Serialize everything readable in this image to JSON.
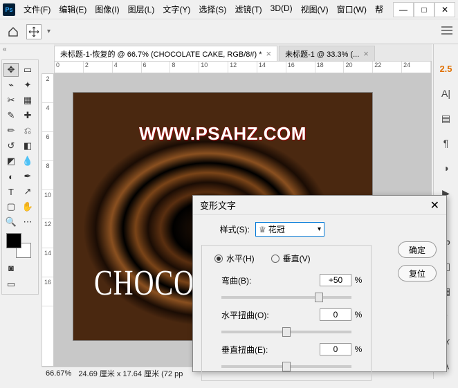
{
  "app": {
    "logo": "Ps"
  },
  "menu": [
    "文件(F)",
    "编辑(E)",
    "图像(I)",
    "图层(L)",
    "文字(Y)",
    "选择(S)",
    "滤镜(T)",
    "3D(D)",
    "视图(V)",
    "窗口(W)",
    "帮"
  ],
  "tabs": [
    {
      "label": "未标题-1-恢复的 @ 66.7% (CHOCOLATE CAKE, RGB/8#) *",
      "active": true
    },
    {
      "label": "未标题-1 @ 33.3% (...",
      "active": false
    }
  ],
  "ruler_h": [
    "0",
    "2",
    "4",
    "6",
    "8",
    "10",
    "12",
    "14",
    "16",
    "18",
    "20",
    "22",
    "24"
  ],
  "ruler_v": [
    "2",
    "4",
    "6",
    "8",
    "10",
    "12",
    "14",
    "16"
  ],
  "canvas": {
    "url_text": "WWW.PSAHZ.COM",
    "cake_text": "CHOCOLAT"
  },
  "right_panel": {
    "accent": "2.5"
  },
  "status": {
    "zoom": "66.67%",
    "dims": "24.69 厘米 x 17.64 厘米 (72 pp"
  },
  "dialog": {
    "title": "变形文字",
    "style_label": "样式(S):",
    "style_value": "花冠",
    "radio_h": "水平(H)",
    "radio_v": "垂直(V)",
    "bend_label": "弯曲(B):",
    "bend_value": "+50",
    "hdist_label": "水平扭曲(O):",
    "hdist_value": "0",
    "vdist_label": "垂直扭曲(E):",
    "vdist_value": "0",
    "pct": "%",
    "ok": "确定",
    "reset": "复位"
  }
}
